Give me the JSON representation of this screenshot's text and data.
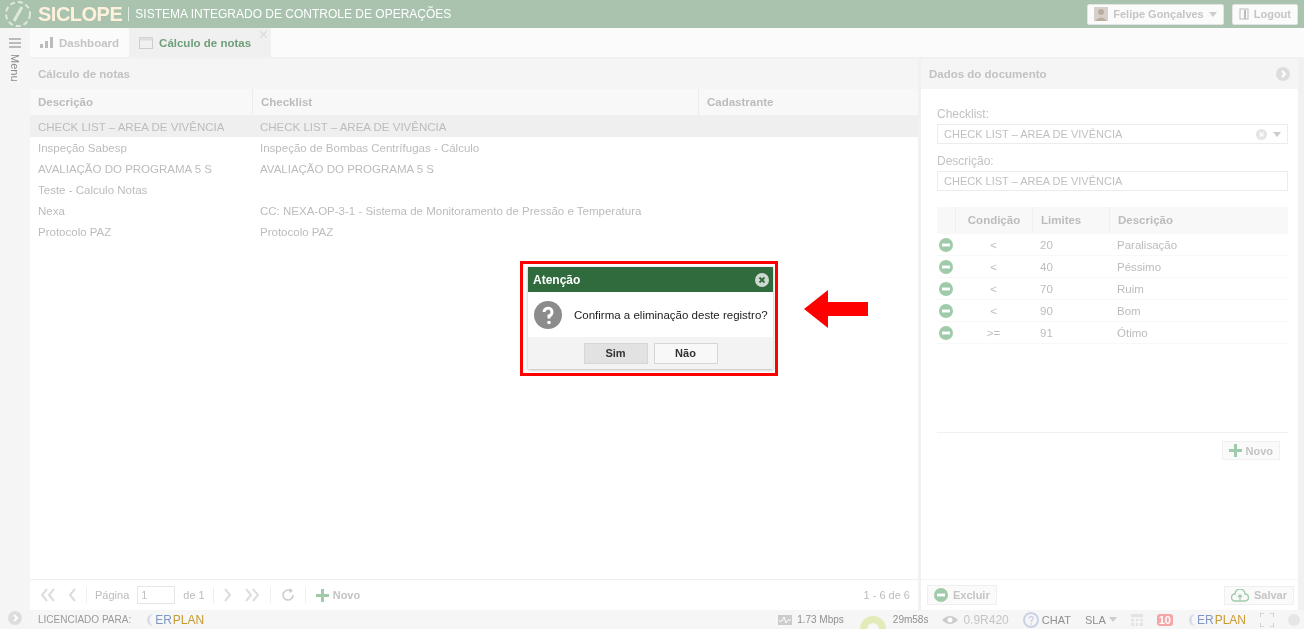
{
  "header": {
    "app_name": "SICLOPE",
    "subtitle": "SISTEMA INTEGRADO DE CONTROLE DE OPERAÇÕES",
    "user": "Felipe Gonçalves",
    "logout": "Logout"
  },
  "sidebar": {
    "label": "Menu"
  },
  "tabs": [
    {
      "label": "Dashboard",
      "selected": false,
      "closable": false
    },
    {
      "label": "Cálculo de notas",
      "selected": true,
      "closable": true
    }
  ],
  "grid": {
    "title": "Cálculo de notas",
    "columns": [
      "Descrição",
      "Checklist",
      "Cadastrante"
    ],
    "rows": [
      {
        "cells": [
          "CHECK LIST – AREA DE VIVÊNCIA",
          "CHECK LIST – AREA DE VIVÊNCIA",
          ""
        ],
        "selected": true
      },
      {
        "cells": [
          "Inspeção Sabesp",
          "Inspeção de Bombas Centrífugas - Cálculo",
          ""
        ],
        "selected": false
      },
      {
        "cells": [
          "AVALIAÇÃO DO PROGRAMA 5 S",
          "AVALIAÇÃO DO PROGRAMA 5 S",
          ""
        ],
        "selected": false
      },
      {
        "cells": [
          "Teste - Calculo Notas",
          "",
          ""
        ],
        "selected": false
      },
      {
        "cells": [
          "Nexa",
          "CC: NEXA-OP-3-1 - Sistema de Monitoramento de Pressão e Temperatura",
          ""
        ],
        "selected": false
      },
      {
        "cells": [
          "Protocolo PAZ",
          "Protocolo PAZ",
          ""
        ],
        "selected": false
      }
    ],
    "pager": {
      "page_label": "Página",
      "page": "1",
      "of": "de 1",
      "new": "Novo",
      "range": "1 - 6 de 6"
    }
  },
  "details": {
    "title": "Dados do documento",
    "checklist_label": "Checklist:",
    "checklist_value": "CHECK LIST – AREA DE VIVÊNCIA",
    "description_label": "Descrição:",
    "description_value": "CHECK LIST – AREA DE VIVÊNCIA",
    "limits": {
      "columns": [
        "Condição",
        "Limites",
        "Descrição"
      ],
      "rows": [
        {
          "condition": "<",
          "limit": "20",
          "description": "Paralisação"
        },
        {
          "condition": "<",
          "limit": "40",
          "description": "Péssimo"
        },
        {
          "condition": "<",
          "limit": "70",
          "description": "Ruim"
        },
        {
          "condition": "<",
          "limit": "90",
          "description": "Bom"
        },
        {
          "condition": ">=",
          "limit": "91",
          "description": "Ótimo"
        }
      ],
      "new": "Novo"
    },
    "delete": "Excluir",
    "save": "Salvar"
  },
  "status_bar": {
    "licensed": "LICENCIADO PARA:",
    "logo": {
      "first": "ER",
      "second": "PLAN"
    },
    "speed": "1.73 Mbps",
    "session": "29m58s",
    "version": "0.9R420",
    "chat": "CHAT",
    "sla": "SLA",
    "notifications": "10",
    "logo_right": {
      "first": "ER",
      "second": "PLAN"
    }
  },
  "dialog": {
    "title": "Atenção",
    "message": "Confirma a eliminação deste registro?",
    "buttons": [
      {
        "label": "Sim",
        "selected": true
      },
      {
        "label": "Não",
        "selected": false
      }
    ]
  }
}
